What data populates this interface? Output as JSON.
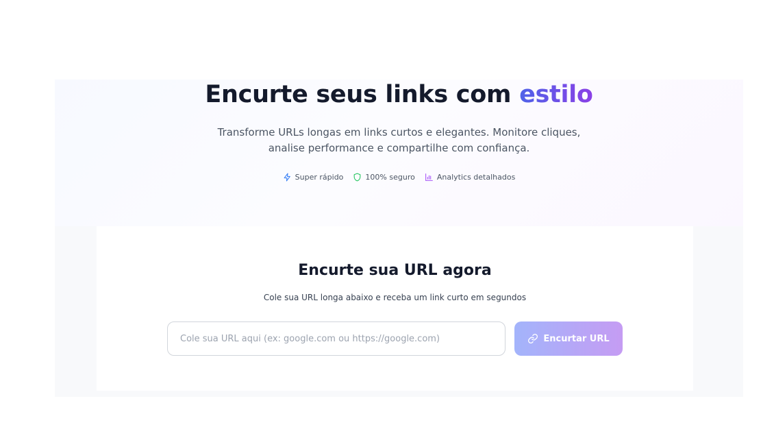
{
  "hero": {
    "title_main": "Encurte seus links com ",
    "title_accent": "estilo",
    "subtitle_line1": "Transforme URLs longas em links curtos e elegantes. Monitore cliques,",
    "subtitle_line2": "analise performance e compartilhe com confiança.",
    "features": [
      {
        "label": "Super rápido",
        "icon": "bolt-icon",
        "color": "#3b82f6"
      },
      {
        "label": "100% seguro",
        "icon": "shield-icon",
        "color": "#22c55e"
      },
      {
        "label": "Analytics detalhados",
        "icon": "bar-chart-icon",
        "color": "#a855f7"
      }
    ]
  },
  "shortener": {
    "title": "Encurte sua URL agora",
    "subtitle": "Cole sua URL longa abaixo e receba um link curto em segundos",
    "input_value": "",
    "input_placeholder": "Cole sua URL aqui (ex: google.com ou https://google.com)",
    "button_label": "Encurtar URL",
    "button_icon": "link-icon"
  },
  "colors": {
    "accent_start": "#4f63e8",
    "accent_end": "#8b3fe6",
    "button_start": "#a3b4fb",
    "button_end": "#c59cf3"
  }
}
